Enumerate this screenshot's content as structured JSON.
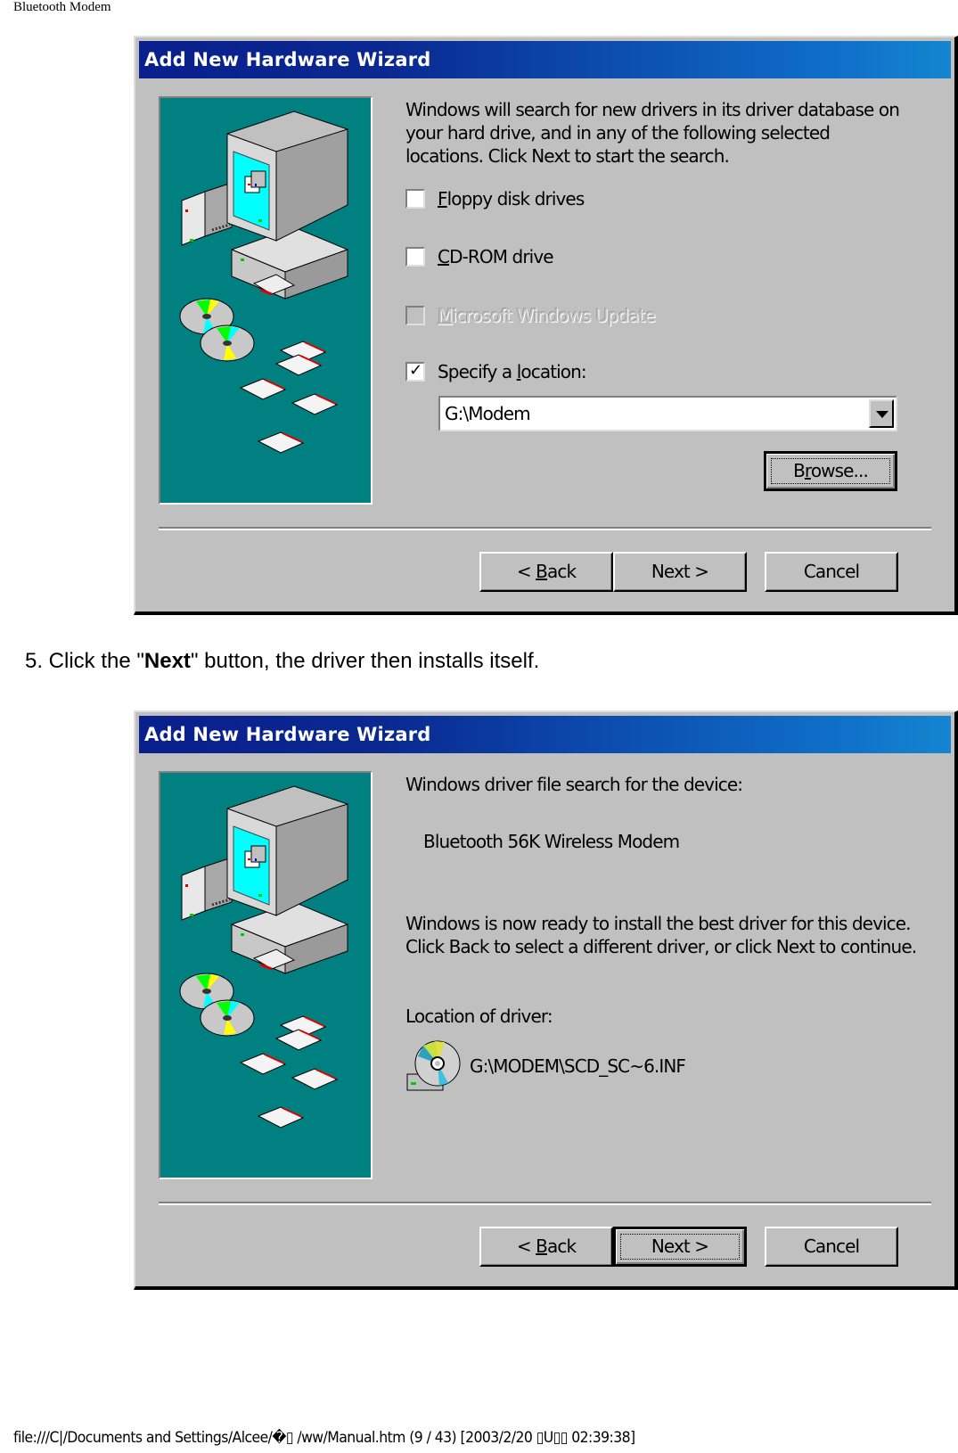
{
  "page": {
    "header": "Bluetooth Modem",
    "step_text_prefix": "5. Click the \"",
    "step_text_bold": "Next",
    "step_text_suffix": "\" button, the driver then installs itself.",
    "footer": "file:///C|/Documents and Settings/Alcee/�▯ /ww/Manual.htm (9 / 43) [2003/2/20 ▯U▯▯ 02:39:38]"
  },
  "dialog1": {
    "title": "Add New Hardware Wizard",
    "intro": "Windows will search for new drivers in its driver database on your hard drive, and in any of the following selected locations. Click Next to start the search.",
    "options": [
      {
        "accel": "F",
        "rest": "loppy disk drives",
        "checked": false,
        "enabled": true
      },
      {
        "accel": "C",
        "rest": "D-ROM drive",
        "checked": false,
        "enabled": true
      },
      {
        "accel": "M",
        "rest": "icrosoft Windows Update",
        "checked": false,
        "enabled": false
      },
      {
        "pre": "Specify a ",
        "accel": "l",
        "rest": "ocation:",
        "checked": true,
        "enabled": true
      }
    ],
    "location_value": "G:\\Modem",
    "browse_pre": "B",
    "browse_accel": "r",
    "browse_rest": "owse...",
    "back_pre": "< ",
    "back_accel": "B",
    "back_rest": "ack",
    "next_label": "Next >",
    "cancel_label": "Cancel"
  },
  "dialog2": {
    "title": "Add New Hardware Wizard",
    "search_heading": "Windows driver file search for the device:",
    "device_name": "Bluetooth 56K Wireless Modem",
    "ready_text": "Windows is now ready to install the best driver for this device. Click Back to select a different driver, or click Next to continue.",
    "location_label": "Location of driver:",
    "driver_path": "G:\\MODEM\\SCD_SC~6.INF",
    "back_pre": "< ",
    "back_accel": "B",
    "back_rest": "ack",
    "next_label": "Next >",
    "cancel_label": "Cancel"
  },
  "colors": {
    "dialog_face": "#c0c0c0",
    "titlebar_start": "#0a1f8c",
    "titlebar_end": "#1485d0",
    "side_panel": "#008080"
  }
}
